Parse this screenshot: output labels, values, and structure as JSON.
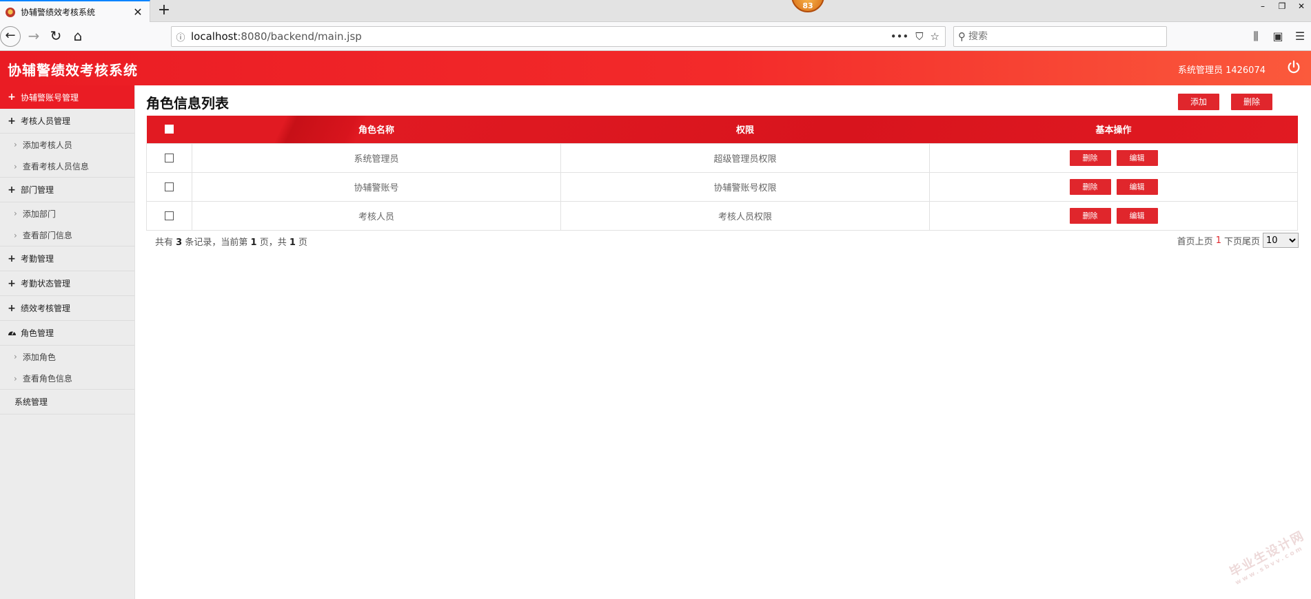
{
  "browser": {
    "tab_title": "协辅警绩效考核系统",
    "tab_close": "✕",
    "new_tab": "+",
    "notification_badge": "83",
    "url_host": "localhost",
    "url_rest": ":8080/backend/main.jsp",
    "search_placeholder": "搜索"
  },
  "header": {
    "app_title": "协辅警绩效考核系统",
    "user_info": "系统管理员 1426074"
  },
  "sidebar": {
    "items": [
      {
        "type": "head",
        "label": "协辅警账号管理",
        "icon": "plus-icon",
        "active": true
      },
      {
        "type": "head",
        "label": "考核人员管理",
        "icon": "plus-icon"
      },
      {
        "type": "sub",
        "label": "添加考核人员"
      },
      {
        "type": "sub",
        "label": "查看考核人员信息"
      },
      {
        "type": "head",
        "label": "部门管理",
        "icon": "plus-icon"
      },
      {
        "type": "sub",
        "label": "添加部门"
      },
      {
        "type": "sub",
        "label": "查看部门信息"
      },
      {
        "type": "head",
        "label": "考勤管理",
        "icon": "plus-icon"
      },
      {
        "type": "head",
        "label": "考勤状态管理",
        "icon": "plus-icon"
      },
      {
        "type": "head",
        "label": "绩效考核管理",
        "icon": "plus-icon"
      },
      {
        "type": "head",
        "label": "角色管理",
        "icon": "dashboard-icon"
      },
      {
        "type": "sub",
        "label": "添加角色"
      },
      {
        "type": "sub",
        "label": "查看角色信息"
      },
      {
        "type": "head",
        "label": "系统管理",
        "icon": ""
      }
    ]
  },
  "main": {
    "title": "角色信息列表",
    "add_label": "添加",
    "delete_label": "删除",
    "columns": [
      "角色名称",
      "权限",
      "基本操作"
    ],
    "rows": [
      {
        "name": "系统管理员",
        "permission": "超级管理员权限"
      },
      {
        "name": "协辅警账号",
        "permission": "协辅警账号权限"
      },
      {
        "name": "考核人员",
        "permission": "考核人员权限"
      }
    ],
    "row_delete_label": "删除",
    "row_edit_label": "编辑",
    "pager": {
      "total_prefix": "共有",
      "total": "3",
      "total_mid": "条记录，当前第",
      "current": "1",
      "pages_mid": "页，共",
      "pages": "1",
      "pages_suffix": "页",
      "first": "首页",
      "prev": "上页",
      "page_num": "1",
      "next": "下页",
      "last": "尾页",
      "page_size": "10"
    }
  },
  "watermark": {
    "main": "毕业生设计网",
    "sub": "www.sbvv.com"
  },
  "colors": {
    "brand_red": "#ea1c24",
    "button_red": "#e0262c"
  }
}
